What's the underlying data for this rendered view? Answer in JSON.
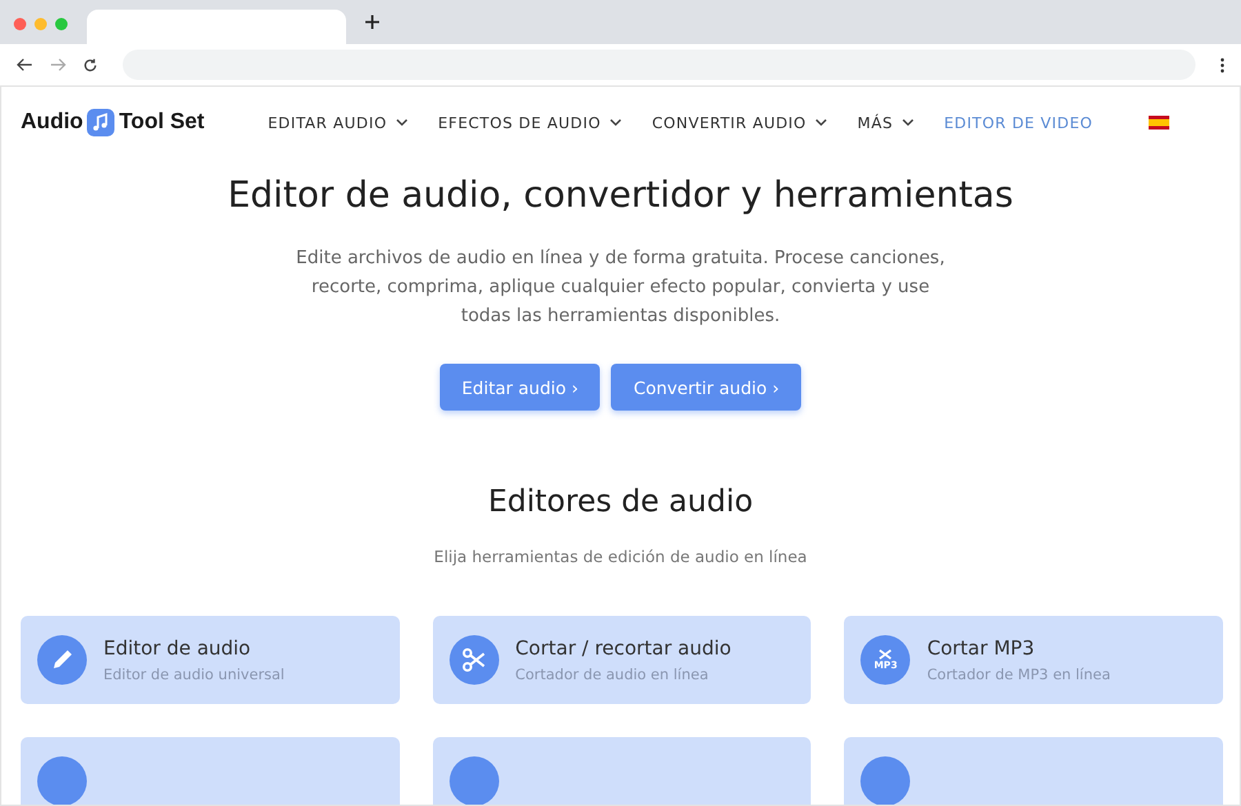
{
  "logo": {
    "left": "Audio",
    "right": "Tool Set"
  },
  "nav": [
    {
      "label": "EDITAR AUDIO",
      "dropdown": true
    },
    {
      "label": "EFECTOS DE AUDIO",
      "dropdown": true
    },
    {
      "label": "CONVERTIR AUDIO",
      "dropdown": true
    },
    {
      "label": "MÁS",
      "dropdown": true
    },
    {
      "label": "EDITOR DE VIDEO",
      "dropdown": false
    }
  ],
  "hero": {
    "title": "Editor de audio, convertidor y herramientas",
    "text": "Edite archivos de audio en línea y de forma gratuita. Procese canciones, recorte, comprima, aplique cualquier efecto popular, convierta y use todas las herramientas disponibles.",
    "buttons": [
      "Editar audio ›",
      "Convertir audio ›"
    ]
  },
  "section": {
    "title": "Editores de audio",
    "subtitle": "Elija herramientas de edición de audio en línea"
  },
  "tools": [
    {
      "kind": "pencil",
      "title": "Editor de audio",
      "subtitle": "Editor de audio universal"
    },
    {
      "kind": "scissors",
      "title": "Cortar / recortar audio",
      "subtitle": "Cortador de audio en línea"
    },
    {
      "kind": "mp3",
      "title": "Cortar MP3",
      "subtitle": "Cortador de MP3 en línea",
      "badge": "MP3"
    },
    {
      "kind": "cut_off"
    },
    {
      "kind": "cut_off"
    },
    {
      "kind": "cut_off"
    }
  ]
}
